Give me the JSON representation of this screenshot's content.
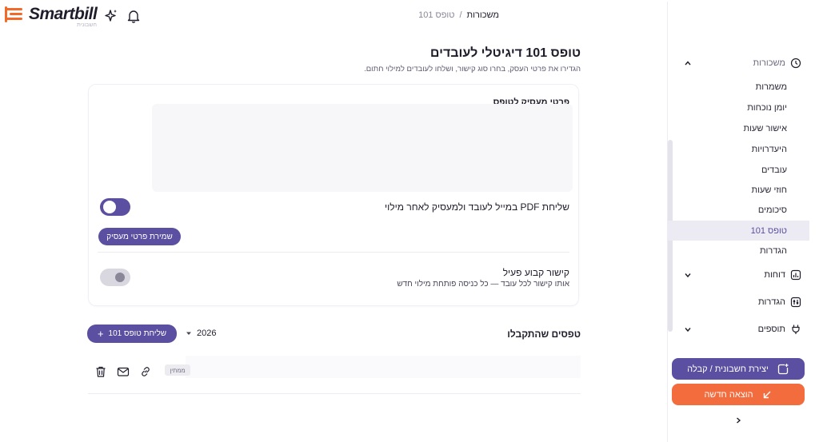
{
  "brand": {
    "name": "Smartbill",
    "sub": "חשבונית",
    "color_primary": "#5a4fa0",
    "color_accent": "#f26c3d"
  },
  "breadcrumb": {
    "parent": "משכורות",
    "separator": "/",
    "current": "טופס 101"
  },
  "sidebar": {
    "section_payroll": "משכורות",
    "items": [
      {
        "label": "משמרות"
      },
      {
        "label": "יומן נוכחות"
      },
      {
        "label": "אישור שעות"
      },
      {
        "label": "היעדרויות"
      },
      {
        "label": "עובדים"
      },
      {
        "label": "חוזי שעות"
      },
      {
        "label": "סיכומים"
      },
      {
        "label": "טופס 101",
        "active": true
      },
      {
        "label": "הגדרות"
      }
    ],
    "section_reports": "דוחות",
    "section_settings": "הגדרות",
    "section_addons": "תוספים",
    "create_button": "יצירת חשבונית / קבלה",
    "expense_button": "הוצאה חדשה"
  },
  "main": {
    "title": "טופס 101 דיגיטלי לעובדים",
    "subtitle": "הגדירו את פרטי העסק, בחרו סוג קישור, ושלחו לעובדים למילוי חתום.",
    "card_heading": "פרטי מעסיק לטופס",
    "pdf_label": "שליחת PDF במייל לעובד ולמעסיק לאחר מילוי",
    "pdf_toggle_on": true,
    "save_button": "שמירת פרטי מעסיק",
    "permalink_label": "קישור קבוע פעיל",
    "permalink_sub": "אותו קישור לכל עובד — כל כניסה פותחת מילוי חדש",
    "permalink_toggle_on": false,
    "forms_title": "טפסים שהתקבלו",
    "year": "2026",
    "send_button": "שליחת טופס 101",
    "row_status": "ממתין"
  }
}
